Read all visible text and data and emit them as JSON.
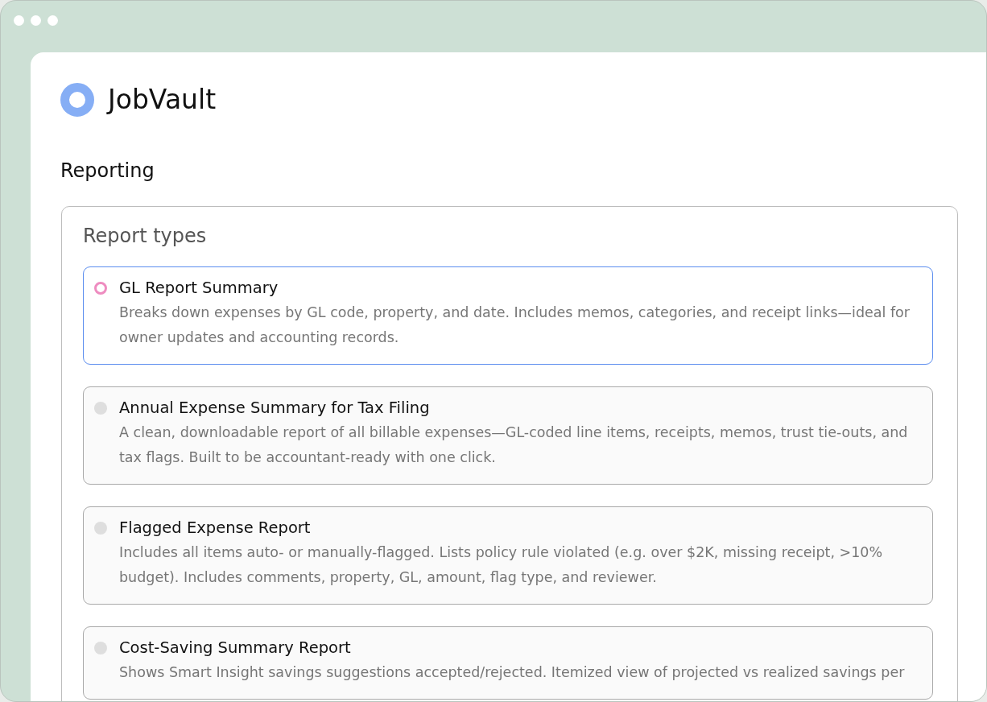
{
  "app": {
    "name": "JobVault"
  },
  "page": {
    "title": "Reporting"
  },
  "report_types": {
    "title": "Report types",
    "options": [
      {
        "title": "GL Report Summary",
        "description": "Breaks down expenses by GL code, property, and date. Includes memos, categories, and receipt links—ideal for owner updates and accounting records.",
        "selected": true
      },
      {
        "title": "Annual Expense Summary for Tax Filing",
        "description": "A clean, downloadable report of all billable expenses—GL-coded line items, receipts, memos, trust tie-outs, and tax flags. Built to be accountant-ready with one click.",
        "selected": false
      },
      {
        "title": "Flagged Expense Report",
        "description": "Includes all items auto- or manually-flagged. Lists policy rule violated (e.g. over $2K, missing receipt, >10% budget). Includes comments, property, GL, amount, flag type, and reviewer.",
        "selected": false
      },
      {
        "title": "Cost-Saving Summary Report",
        "description": "Shows Smart Insight savings suggestions accepted/rejected. Itemized view of projected vs realized savings per",
        "selected": false
      }
    ]
  }
}
